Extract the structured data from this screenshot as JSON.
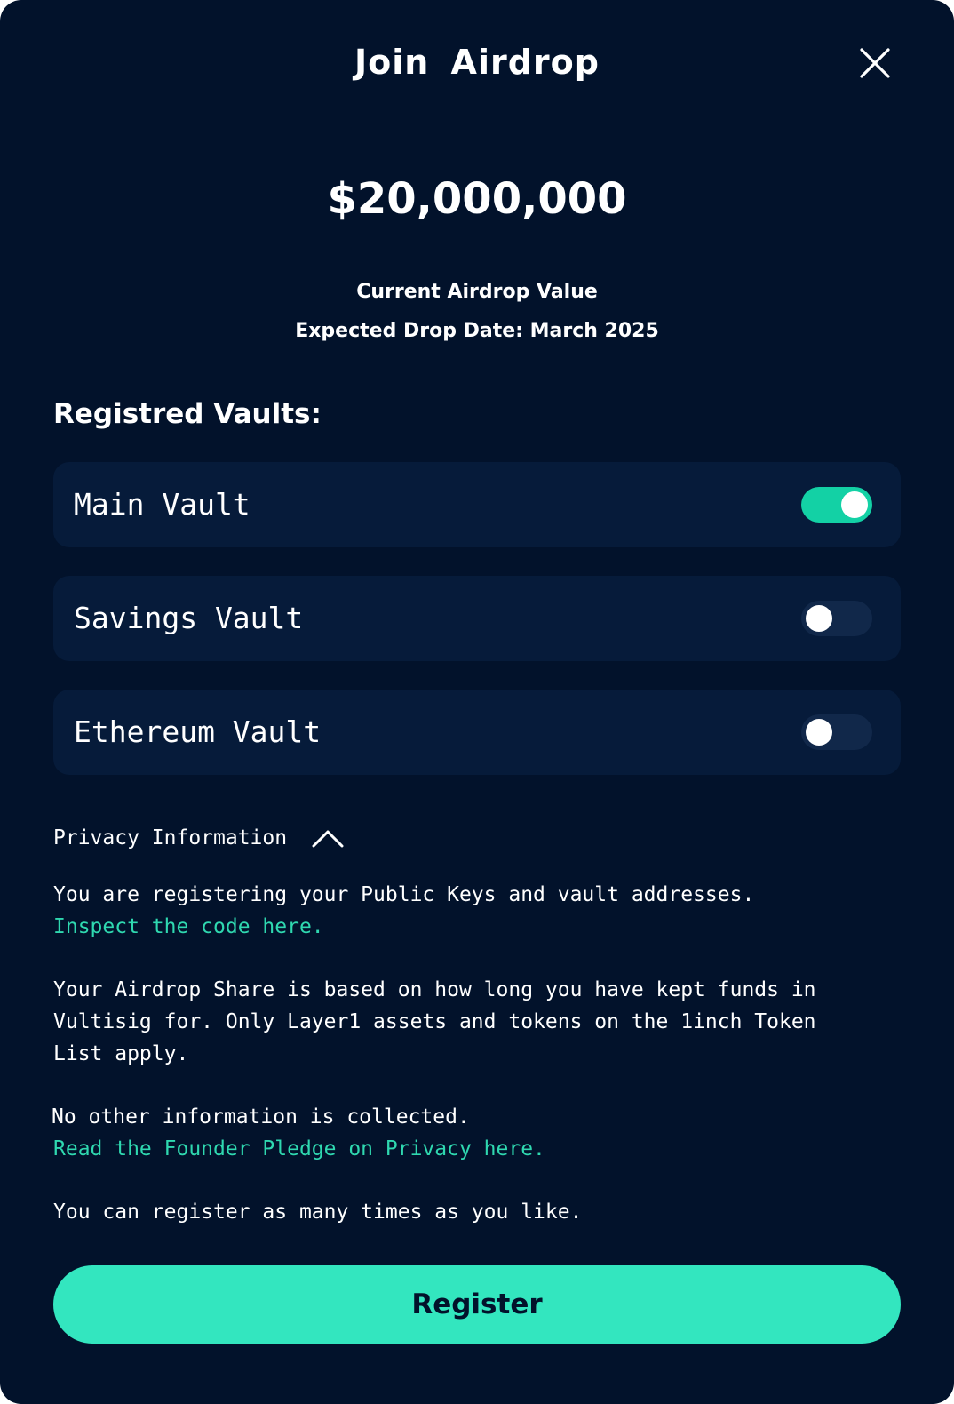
{
  "header": {
    "title": "Join  Airdrop",
    "close_icon": "close-icon"
  },
  "airdrop": {
    "value": "$20,000,000",
    "value_caption": "Current Airdrop Value",
    "drop_date": "Expected Drop Date: March 2025"
  },
  "vaults": {
    "heading": "Registred Vaults:",
    "items": [
      {
        "name": "Main Vault",
        "enabled": true
      },
      {
        "name": "Savings Vault",
        "enabled": false
      },
      {
        "name": "Ethereum Vault",
        "enabled": false
      }
    ]
  },
  "privacy": {
    "toggle_label": "Privacy Information",
    "toggle_icon": "chevron-up-icon",
    "expanded": true,
    "paragraph_1": "You are registering your Public Keys and vault addresses.",
    "link_1": "Inspect the code here.",
    "paragraph_2": "Your Airdrop Share is based on how long you have kept funds in Vultisig for. Only Layer1 assets and tokens on the 1inch Token List apply.",
    "paragraph_3": "No other information is collected.",
    "link_2": "Read the Founder Pledge on Privacy here.",
    "paragraph_4": "You can register as many times as you like."
  },
  "actions": {
    "register_label": "Register"
  },
  "colors": {
    "background": "#02122b",
    "card": "#061b3a",
    "accent": "#33e6bf",
    "toggle_on": "#13d1a5",
    "toggle_off": "#11284a",
    "link": "#2fd8b0"
  }
}
